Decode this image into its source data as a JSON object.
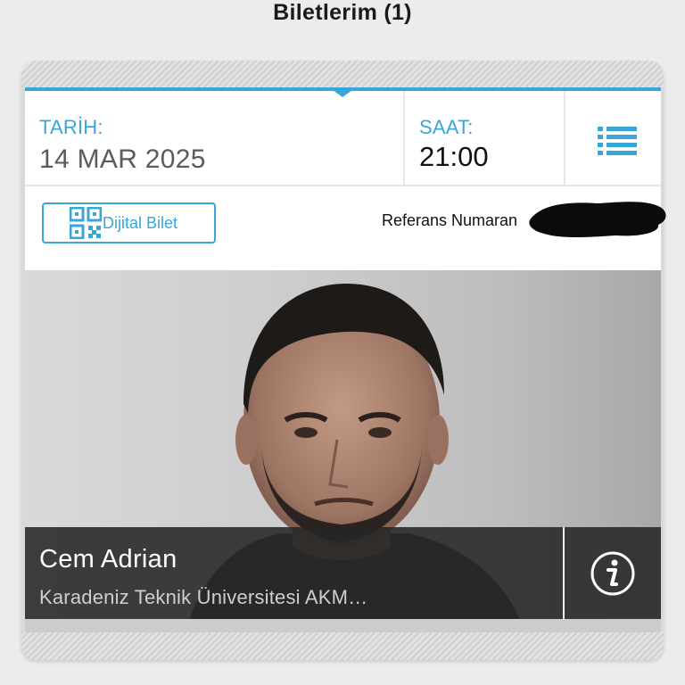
{
  "header": {
    "title": "Biletlerim (1)"
  },
  "ticket": {
    "date_label": "TARİH:",
    "date_value": "14 MAR 2025",
    "time_label": "SAAT:",
    "time_value": "21:00",
    "menu_icon": "list-icon",
    "digital_button": {
      "label": "Dijital Bilet",
      "icon": "qr-code-icon"
    },
    "reference_label": "Referans Numaran",
    "reference_value_redacted": true,
    "event": {
      "artist": "Cem Adrian",
      "venue": "Karadeniz Teknik Üniversitesi AKM…"
    },
    "info_icon": "info-icon"
  },
  "colors": {
    "accent": "#39a6d8",
    "caption_bg": "#262626",
    "page_bg": "#ececec"
  }
}
